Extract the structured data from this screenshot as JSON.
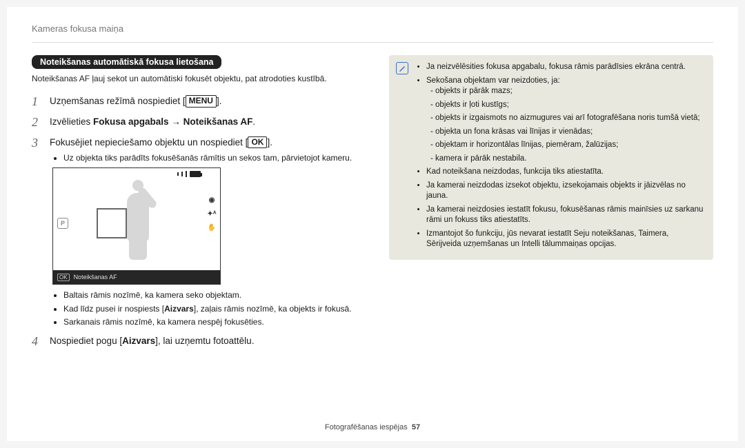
{
  "header": {
    "title": "Kameras fokusa maiņa"
  },
  "left": {
    "badge": "Noteikšanas automātiskā fokusa lietošana",
    "intro": "Noteikšanas AF ļauj sekot un automātiski fokusēt objektu, pat atrodoties kustībā.",
    "steps": {
      "s1_no": "1",
      "s1_pre": "Uzņemšanas režīmā nospiediet [",
      "s1_menu": "MENU",
      "s1_suf": "].",
      "s2_no": "2",
      "s2_pre": "Izvēlieties ",
      "s2_b1": "Fokusa apgabals",
      "s2_mid": " → ",
      "s2_b2": "Noteikšanas AF",
      "s2_suf": ".",
      "s3_no": "3",
      "s3_pre": "Fokusējiet nepieciešamo objektu un nospiediet [",
      "s3_ok": "OK",
      "s3_suf": "].",
      "s3_bullets": [
        "Uz objekta tiks parādīts fokusēšanās rāmītis un sekos tam, pārvietojot kameru."
      ],
      "s4_no": "4",
      "s4_pre": "Nospiediet pogu [",
      "s4_b": "Aizvars",
      "s4_suf": "], lai uzņemtu fotoattēlu."
    },
    "screen": {
      "mode_label": "P",
      "status_prefix": "OK",
      "status_text": "Noteikšanas AF",
      "right_icons": [
        "◉",
        "✦ᴬ",
        "✋"
      ]
    },
    "after_bullets_plain": [
      "Baltais rāmis nozīmē, ka kamera seko objektam."
    ],
    "after_bullets_rich": {
      "b2_pre": "Kad līdz pusei ir nospiests [",
      "b2_bold": "Aizvars",
      "b2_suf": "], zaļais rāmis nozīmē, ka objekts ir fokusā.",
      "b3": "Sarkanais rāmis nozīmē, ka kamera nespēj fokusēties."
    }
  },
  "right": {
    "notes": [
      "Ja neizvēlēsities fokusa apgabalu, fokusa rāmis parādīsies ekrāna centrā.",
      "Sekošana objektam var neizdoties, ja:"
    ],
    "sub_dashes": [
      "objekts ir pārāk mazs;",
      "objekts ir ļoti kustīgs;",
      "objekts ir izgaismots no aizmugures vai arī fotografēšana noris tumšā vietā;",
      "objekta un fona krāsas vai līnijas ir vienādas;",
      "objektam ir horizontālas līnijas, piemēram, žalūzijas;",
      "kamera ir pārāk nestabila."
    ],
    "notes_after": [
      "Kad noteikšana neizdodas, funkcija tiks atiestatīta.",
      "Ja kamerai neizdodas izsekot objektu, izsekojamais objekts ir jāizvēlas no jauna.",
      "Ja kamerai neizdosies iestatīt fokusu, fokusēšanas rāmis mainīsies uz sarkanu rāmi un fokuss tiks atiestatīts.",
      "Izmantojot šo funkciju, jūs nevarat iestatīt Seju noteikšanas, Taimera, Sērijveida uzņemšanas un Intelli tālummaiņas opcijas."
    ]
  },
  "footer": {
    "section": "Fotografēšanas iespējas",
    "page": "57"
  }
}
